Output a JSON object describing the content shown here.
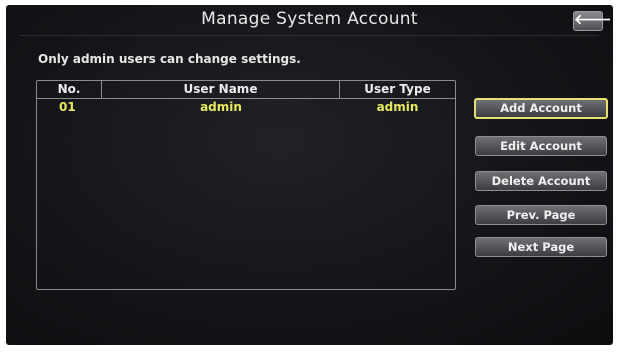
{
  "header": {
    "title": "Manage System Account",
    "back_icon": "back-arrow-icon",
    "back_glyph": "🡐"
  },
  "notice": "Only admin users can change settings.",
  "table": {
    "columns": [
      "No.",
      "User Name",
      "User Type"
    ],
    "rows": [
      {
        "no": "01",
        "name": "admin",
        "type": "admin"
      }
    ]
  },
  "buttons": {
    "add": "Add Account",
    "edit": "Edit Account",
    "delete": "Delete Account",
    "prev": "Prev. Page",
    "next": "Next Page"
  },
  "colors": {
    "background": "#141518",
    "row_text": "#e8e860",
    "selected_border": "#e8e070"
  }
}
